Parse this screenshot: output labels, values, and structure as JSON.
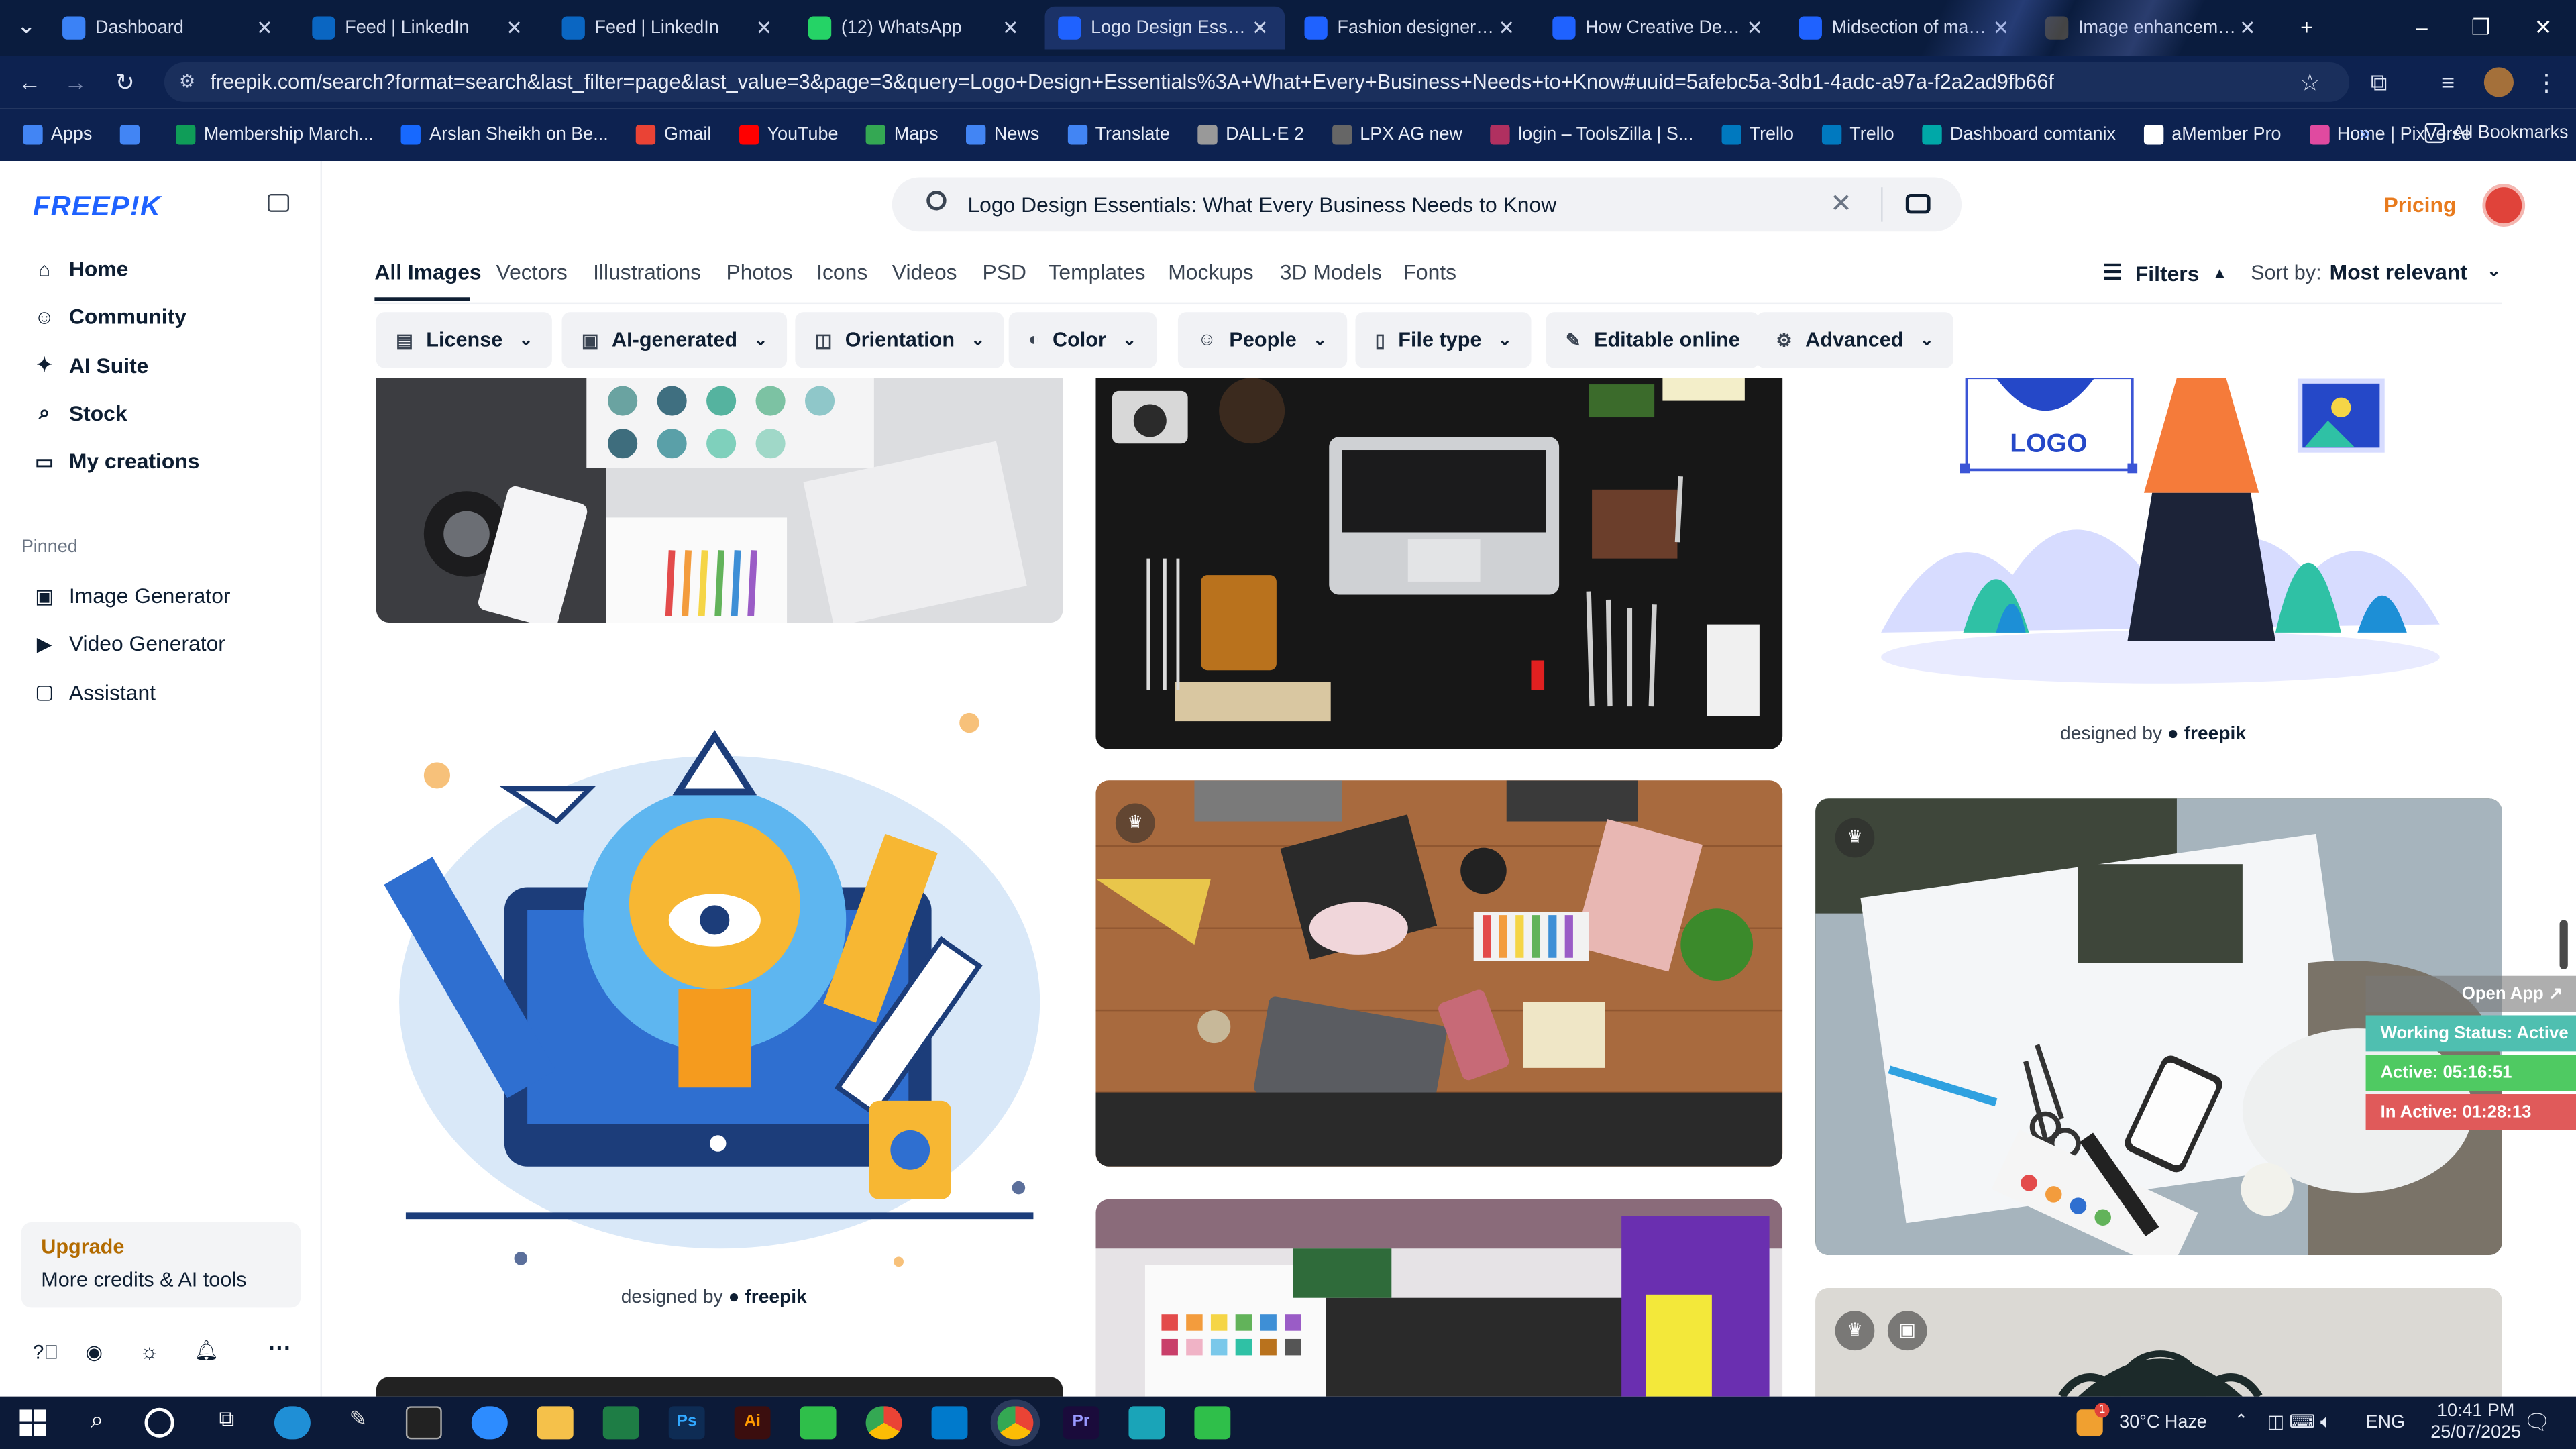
{
  "browser": {
    "tabs": [
      {
        "title": "Dashboard",
        "icon": "globe-icon",
        "color": "#3b82f6"
      },
      {
        "title": "Feed | LinkedIn",
        "icon": "linkedin-icon",
        "color": "#0a66c2"
      },
      {
        "title": "Feed | LinkedIn",
        "icon": "linkedin-icon",
        "color": "#0a66c2"
      },
      {
        "title": "(12) WhatsApp",
        "icon": "whatsapp-icon",
        "color": "#25d366"
      },
      {
        "title": "Logo Design Essentia",
        "icon": "freepik-icon",
        "color": "#1f62ff"
      },
      {
        "title": "Fashion designer ske",
        "icon": "freepik-icon",
        "color": "#1f62ff"
      },
      {
        "title": "How Creative Design",
        "icon": "freepik-icon",
        "color": "#1f62ff"
      },
      {
        "title": "Midsection of man u",
        "icon": "freepik-icon",
        "color": "#1f62ff"
      },
      {
        "title": "Image enhancement",
        "icon": "openai-icon",
        "color": "#444444"
      }
    ],
    "url": "freepik.com/search?format=search&last_filter=page&last_value=3&page=3&query=Logo+Design+Essentials%3A+What+Every+Business+Needs+to+Know#uuid=5afebc5a-3db1-4adc-a97a-f2a2ad9fb66f",
    "bookmarks": [
      {
        "label": "Apps",
        "color": "#4285f4"
      },
      {
        "label": "",
        "color": "#4285f4"
      },
      {
        "label": "Membership March...",
        "color": "#0f9d58"
      },
      {
        "label": "Arslan Sheikh on Be...",
        "color": "#1769ff"
      },
      {
        "label": "Gmail",
        "color": "#ea4335"
      },
      {
        "label": "YouTube",
        "color": "#ff0000"
      },
      {
        "label": "Maps",
        "color": "#34a853"
      },
      {
        "label": "News",
        "color": "#4285f4"
      },
      {
        "label": "Translate",
        "color": "#4285f4"
      },
      {
        "label": "DALL·E 2",
        "color": "#999999"
      },
      {
        "label": "LPX AG new",
        "color": "#666666"
      },
      {
        "label": "login – ToolsZilla | S...",
        "color": "#b03060"
      },
      {
        "label": "Trello",
        "color": "#0079bf"
      },
      {
        "label": "Trello",
        "color": "#0079bf"
      },
      {
        "label": "Dashboard comtanix",
        "color": "#00a8a8"
      },
      {
        "label": "aMember Pro",
        "color": "#ffffff"
      },
      {
        "label": "Home | PixVerse",
        "color": "#e04aa0"
      }
    ],
    "all_bookmarks": "All Bookmarks"
  },
  "sidebar": {
    "logo": "FREEP!K",
    "items": [
      {
        "label": "Home",
        "icon": "home-icon"
      },
      {
        "label": "Community",
        "icon": "community-icon"
      },
      {
        "label": "AI Suite",
        "icon": "sparkle-icon"
      },
      {
        "label": "Stock",
        "icon": "search-icon"
      },
      {
        "label": "My creations",
        "icon": "folder-icon"
      }
    ],
    "pinned_title": "Pinned",
    "pinned": [
      {
        "label": "Image Generator",
        "icon": "image-icon"
      },
      {
        "label": "Video Generator",
        "icon": "video-icon"
      },
      {
        "label": "Assistant",
        "icon": "chat-icon"
      }
    ],
    "upgrade": {
      "title": "Upgrade",
      "subtitle": "More credits & AI tools"
    }
  },
  "search": {
    "query": "Logo Design Essentials: What Every Business Needs to Know"
  },
  "header": {
    "pricing": "Pricing"
  },
  "content_tabs": [
    "All Images",
    "Vectors",
    "Illustrations",
    "Photos",
    "Icons",
    "Videos",
    "PSD",
    "Templates",
    "Mockups",
    "3D Models",
    "Fonts"
  ],
  "active_tab": "All Images",
  "filters_label": "Filters",
  "sort": {
    "label": "Sort by:",
    "value": "Most relevant"
  },
  "filter_chips": [
    {
      "label": "License",
      "icon": "license-icon",
      "dropdown": true
    },
    {
      "label": "AI-generated",
      "icon": "ai-icon",
      "dropdown": true
    },
    {
      "label": "Orientation",
      "icon": "orientation-icon",
      "dropdown": true
    },
    {
      "label": "Color",
      "icon": "color-icon",
      "dropdown": true
    },
    {
      "label": "People",
      "icon": "people-icon",
      "dropdown": true
    },
    {
      "label": "File type",
      "icon": "file-icon",
      "dropdown": true
    },
    {
      "label": "Editable online",
      "icon": "edit-icon",
      "dropdown": false
    },
    {
      "label": "Advanced",
      "icon": "gear-icon",
      "dropdown": true
    }
  ],
  "images": {
    "logo_text": "LOGO",
    "credit_prefix": "designed by",
    "credit_brand": "freepik"
  },
  "tracker": {
    "open_app": "Open App ↗",
    "status": "Working Status: Active",
    "active": "Active: 05:16:51",
    "inactive": "In Active: 01:28:13"
  },
  "taskbar": {
    "weather": "30°C  Haze",
    "lang": "ENG",
    "time": "10:41 PM",
    "date": "25/07/2025",
    "badge": "1"
  }
}
